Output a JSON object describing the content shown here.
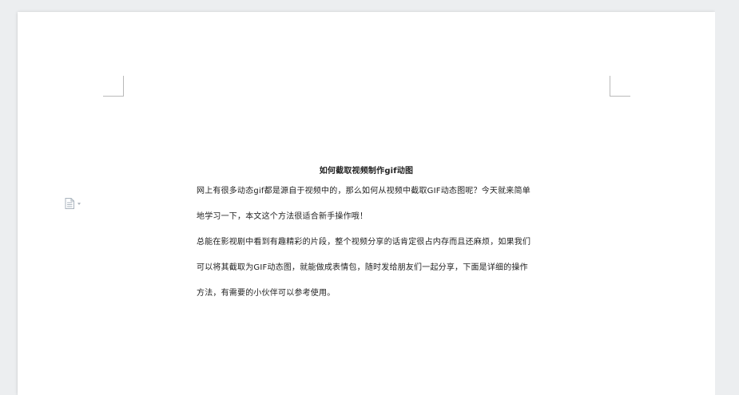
{
  "document": {
    "title": "如何截取视频制作gif动图",
    "paragraphs": [
      "网上有很多动态gif都是源自于视频中的，那么如何从视频中截取GIF动态图呢？今天就来简单地学习一下，本文这个方法很适合新手操作哦！",
      "总能在影视剧中看到有趣精彩的片段，整个视频分享的话肯定很占内存而且还麻烦，如果我们可以将其截取为GIF动态图，就能做成表情包，随时发给朋友们一起分享，下面是详细的操作方法，有需要的小伙伴可以参考使用。"
    ]
  },
  "side_tool": {
    "icon": "document-icon",
    "color": "#a9b3bd"
  },
  "colors": {
    "background": "#eceef0",
    "page": "#ffffff",
    "text": "#222222",
    "crop_marks": "#b9b9b9"
  }
}
